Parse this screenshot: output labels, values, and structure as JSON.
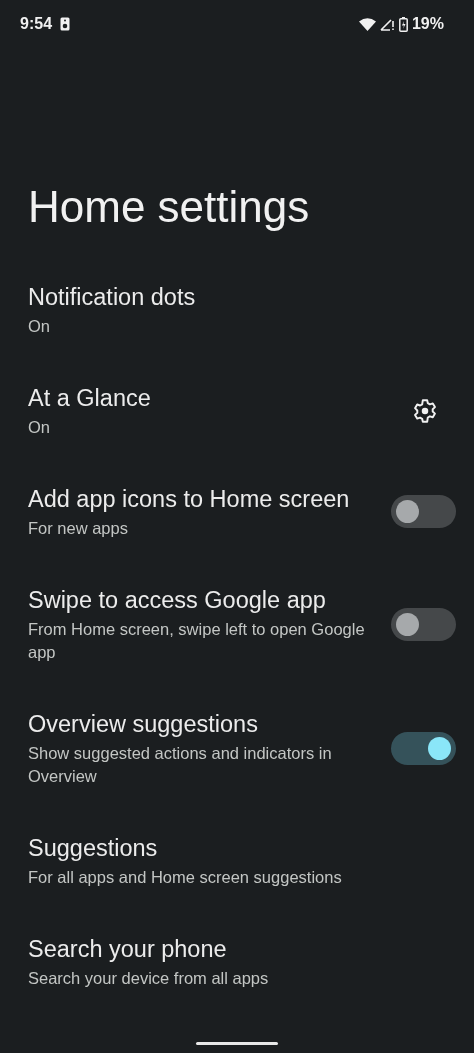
{
  "status_bar": {
    "time": "9:54",
    "battery": "19%"
  },
  "title": "Home settings",
  "items": [
    {
      "kind": "plain",
      "title": "Notification dots",
      "summary": "On"
    },
    {
      "kind": "gear",
      "title": "At a Glance",
      "summary": "On"
    },
    {
      "kind": "switch",
      "title": "Add app icons to Home screen",
      "summary": "For new apps",
      "on": false
    },
    {
      "kind": "switch",
      "title": "Swipe to access Google app",
      "summary": "From Home screen, swipe left to open Google app",
      "on": false
    },
    {
      "kind": "switch",
      "title": "Overview suggestions",
      "summary": "Show suggested actions and indicators in Overview",
      "on": true
    },
    {
      "kind": "plain",
      "title": "Suggestions",
      "summary": "For all apps and Home screen suggestions"
    },
    {
      "kind": "plain",
      "title": "Search your phone",
      "summary": "Search your device from all apps"
    }
  ]
}
